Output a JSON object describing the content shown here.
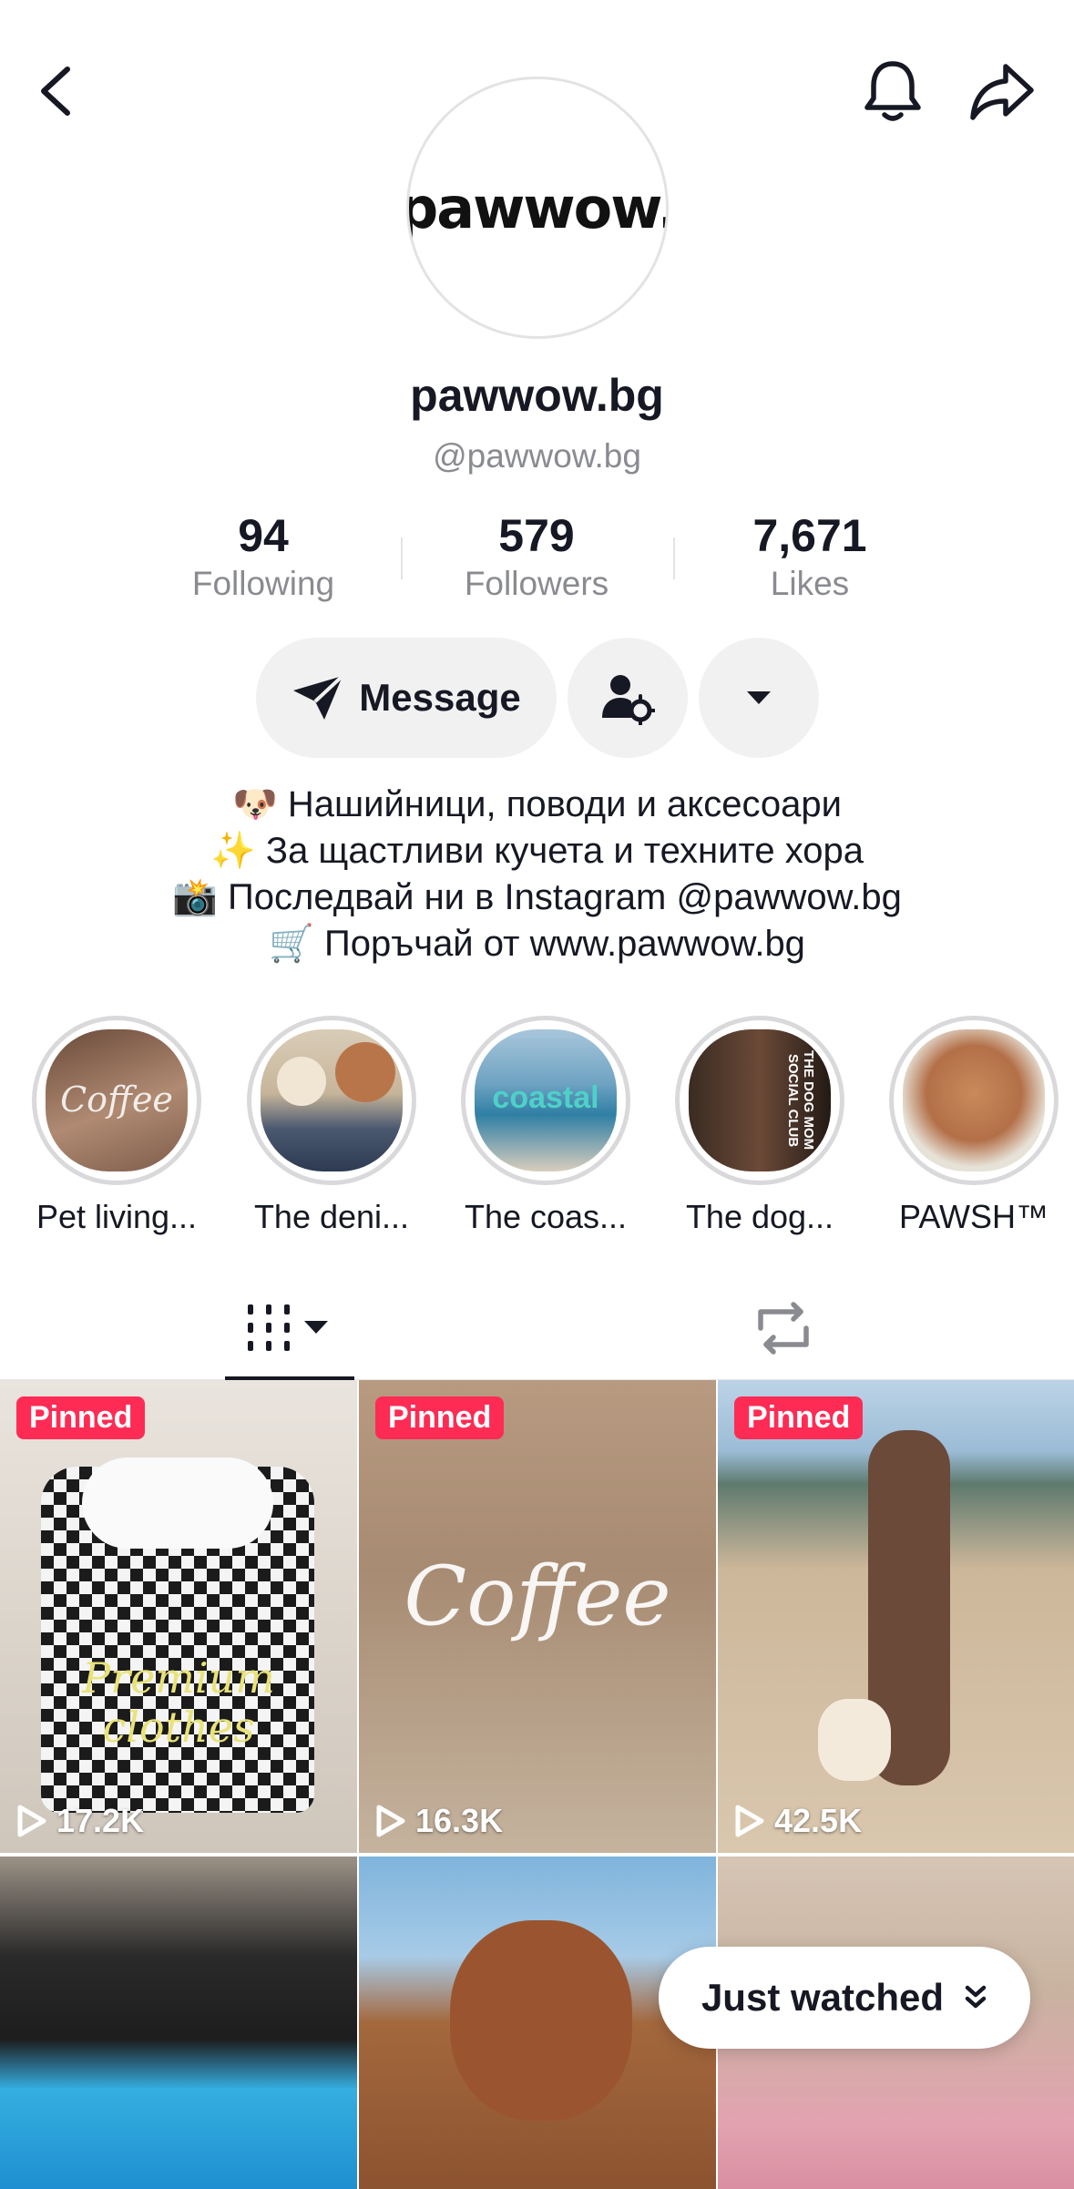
{
  "profile": {
    "display_name": "pawwow.bg",
    "handle": "@pawwow.bg",
    "logo_text": "pawwow."
  },
  "stats": {
    "following": {
      "value": "94",
      "label": "Following"
    },
    "followers": {
      "value": "579",
      "label": "Followers"
    },
    "likes": {
      "value": "7,671",
      "label": "Likes"
    }
  },
  "actions": {
    "message_label": "Message"
  },
  "bio": {
    "lines": [
      "🐶 Нашийници, поводи и аксесоари",
      "✨ За щастливи кучета и техните хора",
      "📸 Последвай ни в Instagram @pawwow.bg",
      "🛒 Поръчай от www.pawwow.bg"
    ]
  },
  "highlights": [
    {
      "label": "Pet living...",
      "image_text": "Coffee"
    },
    {
      "label": "The deni...",
      "image_text": ""
    },
    {
      "label": "The coas...",
      "image_text": "coastal"
    },
    {
      "label": "The dog...",
      "image_text": "THE DOG MOM SOCIAL CLUB"
    },
    {
      "label": "PAWSH™",
      "image_text": ""
    }
  ],
  "videos": [
    {
      "pinned": true,
      "badge": "Pinned",
      "views": "17.2K",
      "overlay_text": "Premium clothes"
    },
    {
      "pinned": true,
      "badge": "Pinned",
      "views": "16.3K",
      "overlay_text": "Coffee"
    },
    {
      "pinned": true,
      "badge": "Pinned",
      "views": "42.5K",
      "overlay_text": ""
    },
    {
      "pinned": false,
      "badge": "",
      "views": "",
      "overlay_text": ""
    },
    {
      "pinned": false,
      "badge": "",
      "views": "",
      "overlay_text": ""
    },
    {
      "pinned": false,
      "badge": "",
      "views": "",
      "overlay_text": ""
    }
  ],
  "floating": {
    "just_watched_label": "Just watched"
  },
  "colors": {
    "accent": "#fe2c55",
    "text": "#161823",
    "muted": "#8a8b91",
    "button_bg": "#f1f1f2"
  }
}
